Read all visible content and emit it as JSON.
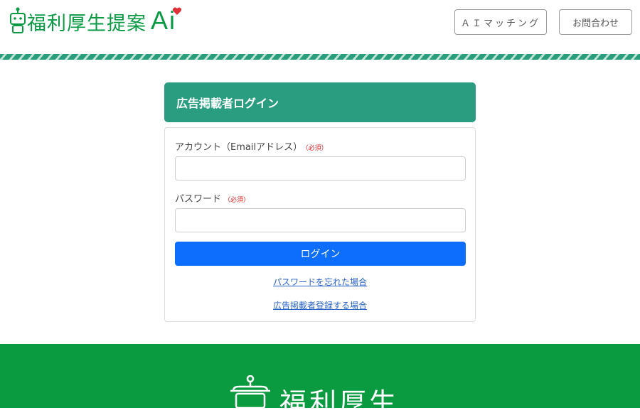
{
  "header": {
    "logo": {
      "text": "福利厚生提案",
      "suffix": "Ai"
    },
    "buttons": {
      "ai_matching": "ＡＩマッチング",
      "contact": "お問合わせ"
    }
  },
  "login": {
    "title": "広告掲載者ログイン",
    "account_label": "アカウント（Emailアドレス）",
    "password_label": "パスワード",
    "required_mark": "（必須）",
    "account_value": "",
    "password_value": "",
    "submit_label": "ログイン",
    "forgot_link": "パスワードを忘れた場合",
    "register_link": "広告掲載者登録する場合"
  },
  "footer": {
    "logo_text": "福利厚生"
  },
  "colors": {
    "brand_green": "#0a9a44",
    "header_teal": "#2a9d80",
    "primary_blue": "#0d6efd",
    "footer_green": "#0a9a3f",
    "required_red": "#e02020",
    "heart_red": "#e0303a"
  },
  "icons": [
    "robot-mascot-icon",
    "heart-icon",
    "footer-robot-icon"
  ]
}
